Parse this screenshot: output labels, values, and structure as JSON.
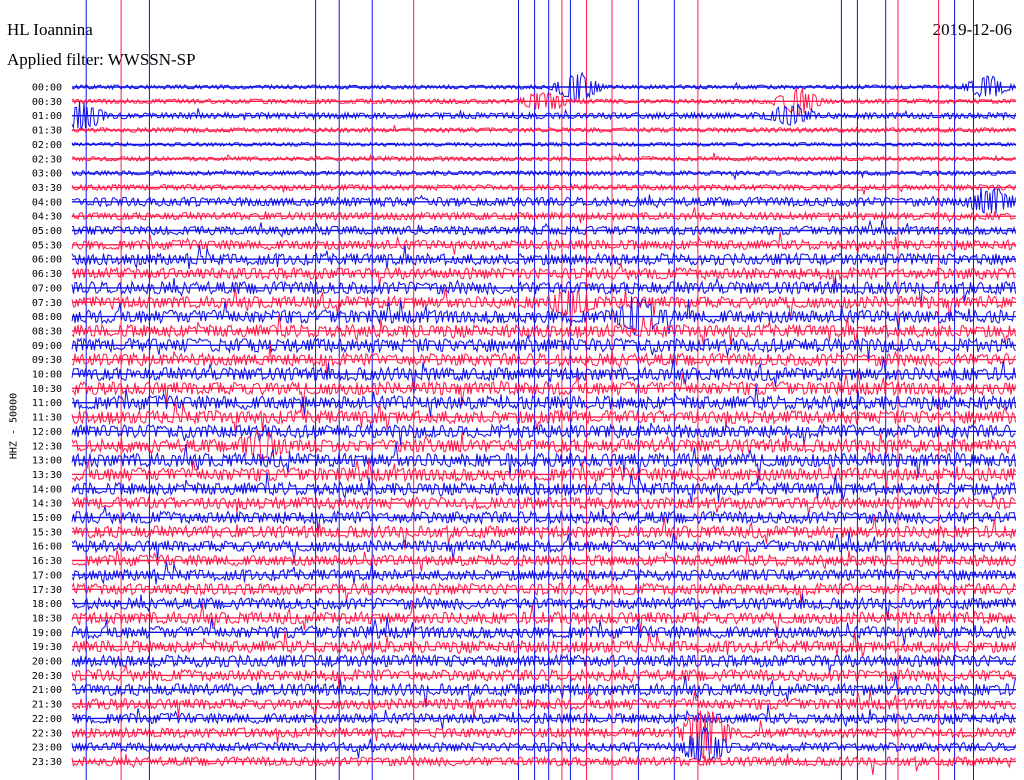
{
  "header": {
    "station": "HL Ioannina",
    "filter": "Applied filter: WWSSN-SP",
    "date": "2019-12-06"
  },
  "chart_data": {
    "type": "line",
    "title": "HL Ioannina",
    "subtitle": "Applied filter: WWSSN-SP",
    "date": "2019-12-06",
    "ylabel": "HHZ - 50000",
    "colors": {
      "even": "#1010e8",
      "odd": "#ff1a4a"
    },
    "rows": [
      "00:00",
      "00:30",
      "01:00",
      "01:30",
      "02:00",
      "02:30",
      "03:00",
      "03:30",
      "04:00",
      "04:30",
      "05:00",
      "05:30",
      "06:00",
      "06:30",
      "07:00",
      "07:30",
      "08:00",
      "08:30",
      "09:00",
      "09:30",
      "10:00",
      "10:30",
      "11:00",
      "11:30",
      "12:00",
      "12:30",
      "13:00",
      "13:30",
      "14:00",
      "14:30",
      "15:00",
      "15:30",
      "16:00",
      "16:30",
      "17:00",
      "17:30",
      "18:00",
      "18:30",
      "19:00",
      "19:30",
      "20:00",
      "20:30",
      "21:00",
      "21:30",
      "22:00",
      "22:30",
      "23:00",
      "23:30"
    ],
    "noise_level": [
      0.15,
      0.2,
      0.35,
      0.2,
      0.12,
      0.18,
      0.2,
      0.3,
      0.6,
      0.45,
      0.55,
      0.65,
      0.8,
      0.8,
      0.9,
      0.85,
      0.95,
      0.9,
      1,
      0.9,
      0.95,
      0.95,
      1,
      0.95,
      0.95,
      0.95,
      1,
      0.95,
      0.9,
      0.85,
      0.85,
      0.85,
      0.8,
      0.75,
      0.75,
      0.8,
      0.8,
      0.85,
      0.85,
      0.85,
      0.85,
      0.8,
      0.85,
      0.75,
      0.7,
      0.65,
      0.6,
      0.6
    ],
    "events": [
      {
        "row": 0,
        "t": 0.535,
        "amp": 1.6
      },
      {
        "row": 0,
        "t": 0.97,
        "amp": 1.2
      },
      {
        "row": 1,
        "t": 0.5,
        "amp": 1.0
      },
      {
        "row": 1,
        "t": 0.77,
        "amp": 1.3
      },
      {
        "row": 2,
        "t": 0.01,
        "amp": 1.4
      },
      {
        "row": 2,
        "t": 0.76,
        "amp": 1.0
      },
      {
        "row": 8,
        "t": 0.975,
        "amp": 1.2
      },
      {
        "row": 15,
        "t": 0.53,
        "amp": 1.3
      },
      {
        "row": 16,
        "t": 0.6,
        "amp": 1.6
      },
      {
        "row": 25,
        "t": 0.2,
        "amp": 1.2
      },
      {
        "row": 45,
        "t": 0.67,
        "amp": 2.5
      },
      {
        "row": 46,
        "t": 0.67,
        "amp": 1.6
      }
    ],
    "marker_lines": [
      {
        "t": 0.015,
        "color": "#1010e8"
      },
      {
        "t": 0.052,
        "color": "#ff1a4a"
      },
      {
        "t": 0.082,
        "color": "#1010e8"
      },
      {
        "t": 0.258,
        "color": "#1010e8"
      },
      {
        "t": 0.283,
        "color": "#1010e8"
      },
      {
        "t": 0.318,
        "color": "#1010e8"
      },
      {
        "t": 0.362,
        "color": "#ff1a4a"
      },
      {
        "t": 0.473,
        "color": "#1010e8"
      },
      {
        "t": 0.49,
        "color": "#1010e8"
      },
      {
        "t": 0.505,
        "color": "#1010e8"
      },
      {
        "t": 0.519,
        "color": "#ff1a4a"
      },
      {
        "t": 0.528,
        "color": "#1010e8"
      },
      {
        "t": 0.545,
        "color": "#ff1a4a"
      },
      {
        "t": 0.572,
        "color": "#ff1a4a"
      },
      {
        "t": 0.6,
        "color": "#1010e8"
      },
      {
        "t": 0.638,
        "color": "#1010e8"
      },
      {
        "t": 0.663,
        "color": "#ff1a4a"
      },
      {
        "t": 0.815,
        "color": "#1010e8"
      },
      {
        "t": 0.832,
        "color": "#1010e8"
      },
      {
        "t": 0.862,
        "color": "#1010e8"
      },
      {
        "t": 0.875,
        "color": "#ff1a4a"
      },
      {
        "t": 0.918,
        "color": "#ff1a4a"
      },
      {
        "t": 0.935,
        "color": "#1010e8"
      },
      {
        "t": 0.955,
        "color": "#1010e8"
      }
    ]
  }
}
